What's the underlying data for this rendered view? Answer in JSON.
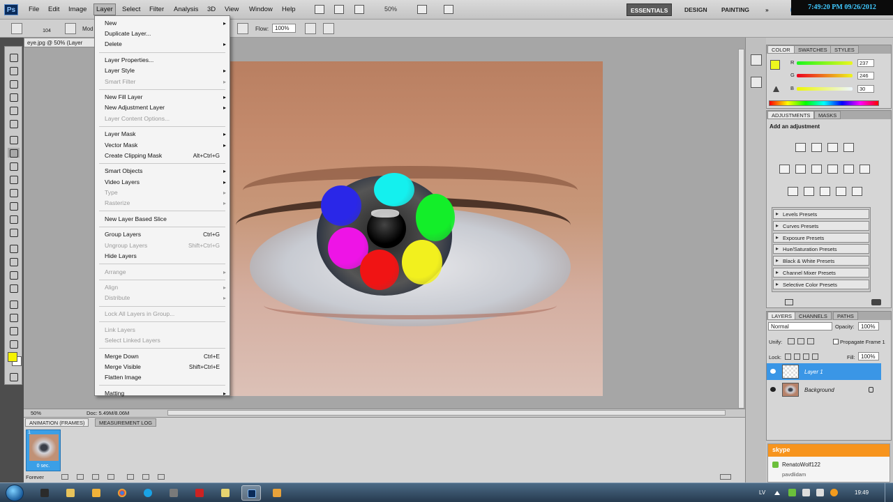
{
  "menubar": {
    "logo": "Ps",
    "items": [
      "File",
      "Edit",
      "Image",
      "Layer",
      "Select",
      "Filter",
      "Analysis",
      "3D",
      "View",
      "Window",
      "Help"
    ],
    "zoom": "50%",
    "workspaces": [
      "ESSENTIALS",
      "DESIGN",
      "PAINTING"
    ],
    "more": "»",
    "clock": "7:49:20 PM 09/26/2012"
  },
  "options_bar": {
    "brush_size": "104",
    "mode_label": "Mod",
    "flow_label": "Flow:",
    "flow_value": "100%"
  },
  "document": {
    "tab_title": "eye.jpg @ 50% (Layer",
    "status_zoom": "50%",
    "status_doc": "Doc: 5.49M/8.06M"
  },
  "layer_menu": {
    "items": [
      {
        "label": "New",
        "arrow": true
      },
      {
        "label": "Duplicate Layer..."
      },
      {
        "label": "Delete",
        "arrow": true
      },
      {
        "sep": true
      },
      {
        "label": "Layer Properties..."
      },
      {
        "label": "Layer Style",
        "arrow": true
      },
      {
        "label": "Smart Filter",
        "arrow": true,
        "disabled": true
      },
      {
        "sep": true
      },
      {
        "label": "New Fill Layer",
        "arrow": true
      },
      {
        "label": "New Adjustment Layer",
        "arrow": true
      },
      {
        "label": "Layer Content Options...",
        "disabled": true
      },
      {
        "sep": true
      },
      {
        "label": "Layer Mask",
        "arrow": true
      },
      {
        "label": "Vector Mask",
        "arrow": true
      },
      {
        "label": "Create Clipping Mask",
        "shortcut": "Alt+Ctrl+G"
      },
      {
        "sep": true
      },
      {
        "label": "Smart Objects",
        "arrow": true
      },
      {
        "label": "Video Layers",
        "arrow": true
      },
      {
        "label": "Type",
        "arrow": true,
        "disabled": true
      },
      {
        "label": "Rasterize",
        "arrow": true,
        "disabled": true
      },
      {
        "sep": true
      },
      {
        "label": "New Layer Based Slice"
      },
      {
        "sep": true
      },
      {
        "label": "Group Layers",
        "shortcut": "Ctrl+G"
      },
      {
        "label": "Ungroup Layers",
        "shortcut": "Shift+Ctrl+G",
        "disabled": true
      },
      {
        "label": "Hide Layers"
      },
      {
        "sep": true
      },
      {
        "label": "Arrange",
        "arrow": true,
        "disabled": true
      },
      {
        "sep": true
      },
      {
        "label": "Align",
        "arrow": true,
        "disabled": true
      },
      {
        "label": "Distribute",
        "arrow": true,
        "disabled": true
      },
      {
        "sep": true
      },
      {
        "label": "Lock All Layers in Group...",
        "disabled": true
      },
      {
        "sep": true
      },
      {
        "label": "Link Layers",
        "disabled": true
      },
      {
        "label": "Select Linked Layers",
        "disabled": true
      },
      {
        "sep": true
      },
      {
        "label": "Merge Down",
        "shortcut": "Ctrl+E"
      },
      {
        "label": "Merge Visible",
        "shortcut": "Shift+Ctrl+E"
      },
      {
        "label": "Flatten Image"
      },
      {
        "sep": true
      },
      {
        "label": "Matting",
        "arrow": true
      }
    ]
  },
  "color_panel": {
    "tabs": [
      "COLOR",
      "SWATCHES",
      "STYLES"
    ],
    "channels": [
      {
        "label": "R",
        "value": "237"
      },
      {
        "label": "G",
        "value": "246"
      },
      {
        "label": "B",
        "value": "30"
      }
    ],
    "foreground": "#edf61e"
  },
  "adjustments_panel": {
    "tabs": [
      "ADJUSTMENTS",
      "MASKS"
    ],
    "heading": "Add an adjustment",
    "presets": [
      "Levels Presets",
      "Curves Presets",
      "Exposure Presets",
      "Hue/Saturation Presets",
      "Black & White Presets",
      "Channel Mixer Presets",
      "Selective Color Presets"
    ]
  },
  "layers_panel": {
    "tabs": [
      "LAYERS",
      "CHANNELS",
      "PATHS"
    ],
    "blend_mode": "Normal",
    "opacity_label": "Opacity:",
    "opacity": "100%",
    "unify_label": "Unify:",
    "propagate_label": "Propagate Frame 1",
    "lock_label": "Lock:",
    "fill_label": "Fill:",
    "fill": "100%",
    "layers": [
      {
        "name": "Layer 1",
        "selected": true
      },
      {
        "name": "Background",
        "selected": false
      }
    ]
  },
  "animation_panel": {
    "tabs": [
      "ANIMATION (FRAMES)",
      "MEASUREMENT LOG"
    ],
    "frame_number": "1",
    "frame_time": "0 sec.",
    "loop": "Forever"
  },
  "skype_toast": {
    "title": "skype",
    "user": "RenatoWolf122",
    "message": "pavdlidam"
  },
  "taskbar": {
    "lang": "LV",
    "time": "19:49"
  },
  "colors": {
    "dot_blue": "#2a27e8",
    "dot_cyan": "#14f0ee",
    "dot_green": "#13ee29",
    "dot_magenta": "#ee14e6",
    "dot_red": "#f01414",
    "dot_yellow": "#f2f01e",
    "accent_selection": "#3a96e6"
  }
}
